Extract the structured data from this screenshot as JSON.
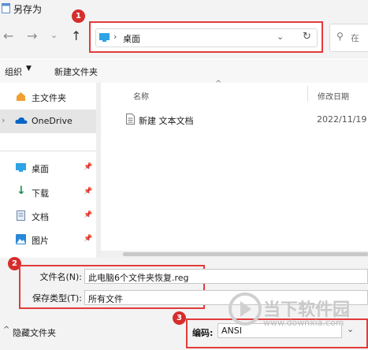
{
  "window": {
    "title": "另存为"
  },
  "nav": {
    "address_path": "桌面",
    "search_placeholder": "在"
  },
  "annotations": {
    "badge1": "1",
    "badge2": "2",
    "badge3": "3"
  },
  "toolbar": {
    "organize": "组织",
    "new_folder": "新建文件夹"
  },
  "sidebar": {
    "items": [
      {
        "label": "主文件夹"
      },
      {
        "label": "OneDrive"
      },
      {
        "label": "桌面"
      },
      {
        "label": "下载"
      },
      {
        "label": "文档"
      },
      {
        "label": "图片"
      }
    ]
  },
  "file_list": {
    "headers": {
      "name": "名称",
      "modified": "修改日期"
    },
    "rows": [
      {
        "name": "新建 文本文档",
        "date": "2022/11/19"
      }
    ]
  },
  "save_form": {
    "filename_label": "文件名(N):",
    "filename_value": "此电脑6个文件夹恢复.reg",
    "type_label": "保存类型(T):",
    "type_value": "所有文件",
    "hide_folders": "隐藏文件夹",
    "encoding_label": "编码:",
    "encoding_value": "ANSI"
  },
  "watermark": {
    "brand": "当下软件园",
    "url": "www.downxia.com"
  },
  "colors": {
    "annotation_red": "#e23b3b",
    "onedrive_blue": "#0a64c8",
    "folder_blue": "#2b88d8"
  }
}
